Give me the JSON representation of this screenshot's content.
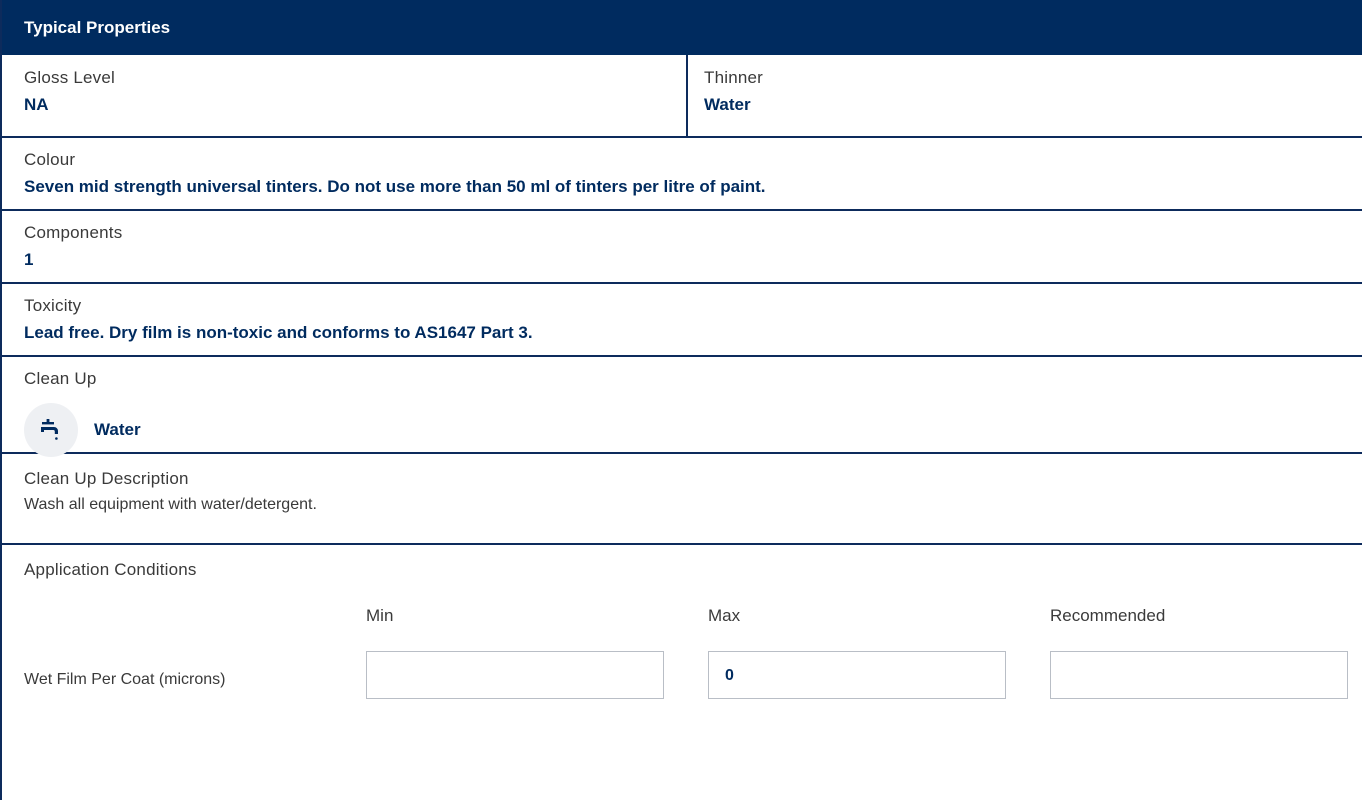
{
  "header": {
    "title": "Typical Properties"
  },
  "gloss_level": {
    "label": "Gloss Level",
    "value": "NA"
  },
  "thinner": {
    "label": "Thinner",
    "value": "Water"
  },
  "colour": {
    "label": "Colour",
    "value": "Seven mid strength universal tinters. Do not use more than 50 ml of tinters per litre of paint."
  },
  "components": {
    "label": "Components",
    "value": "1"
  },
  "toxicity": {
    "label": "Toxicity",
    "value": "Lead free. Dry film is non-toxic and conforms to AS1647 Part 3."
  },
  "clean_up": {
    "label": "Clean Up",
    "icon": "water-tap-icon",
    "value": "Water"
  },
  "clean_up_description": {
    "label": "Clean Up Description",
    "value": "Wash all equipment with water/detergent."
  },
  "application_conditions": {
    "label": "Application Conditions",
    "columns": {
      "min": "Min",
      "max": "Max",
      "recommended": "Recommended"
    },
    "rows": [
      {
        "label": "Wet Film Per Coat (microns)",
        "min": "",
        "max": "0",
        "recommended": ""
      }
    ]
  },
  "colors": {
    "header_bg": "#002b5f",
    "accent_text": "#002b5f",
    "divider": "#0d2b5c",
    "icon_bg": "#eef0f3"
  }
}
